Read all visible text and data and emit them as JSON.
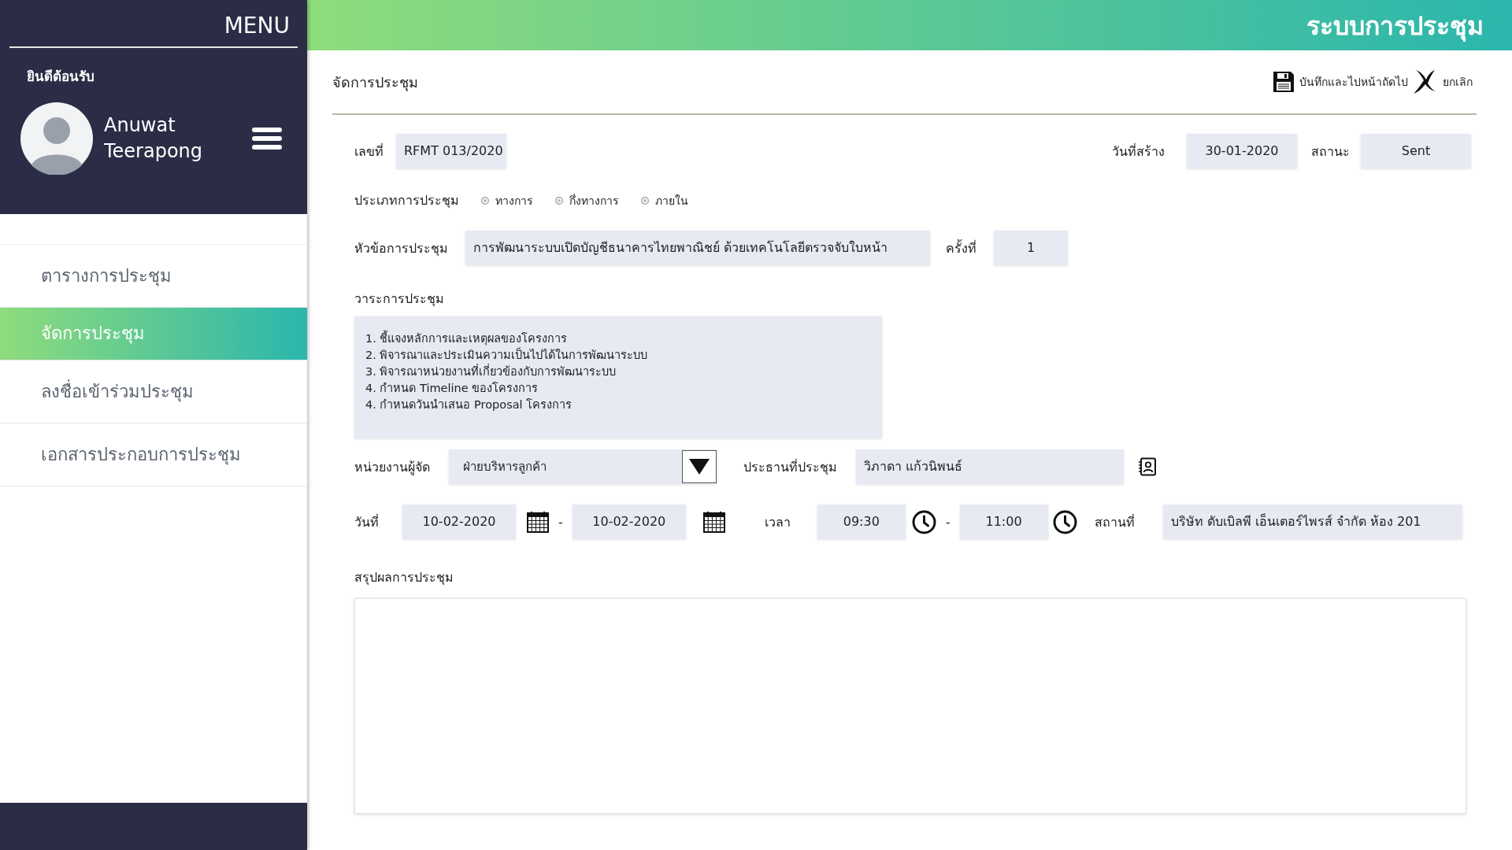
{
  "sidebar": {
    "menu_title": "MENU",
    "welcome": "ยินดีต้อนรับ",
    "user_name": "Anuwat Teerapong",
    "items": [
      {
        "label": "ตารางการประชุม",
        "selected": false
      },
      {
        "label": "จัดการประชุม",
        "selected": true
      },
      {
        "label": "ลงชื่อเข้าร่วมประชุม",
        "selected": false
      },
      {
        "label": "เอกสารประกอบการประชุม",
        "selected": false
      }
    ]
  },
  "header": {
    "title": "ระบบการประชุม"
  },
  "page": {
    "title": "จัดการประชุม",
    "actions": [
      {
        "kind": "save",
        "label": "บันทึกและไปหน้าถัดไป"
      },
      {
        "kind": "cancel",
        "label": "ยกเลิก"
      }
    ]
  },
  "form": {
    "number": {
      "label": "เลขที่",
      "value": "RFMT 013/2020"
    },
    "created": {
      "label": "วันที่สร้าง",
      "value": "30-01-2020"
    },
    "status": {
      "label": "สถานะ",
      "value": "Sent"
    },
    "meeting_type": {
      "label": "ประเภทการประชุม",
      "options": [
        {
          "label": "ทางการ",
          "selected": false
        },
        {
          "label": "กึ่งทางการ",
          "selected": false
        },
        {
          "label": "ภายใน",
          "selected": false
        }
      ]
    },
    "topic": {
      "label": "หัวข้อการประชุม",
      "value": "การพัฒนาระบบเปิดบัญชีธนาคารไทยพาณิชย์ ด้วยเทคโนโลยีตรวจจับใบหน้า"
    },
    "session": {
      "label": "ครั้งที่",
      "value": "1"
    },
    "agenda": {
      "label": "วาระการประชุม",
      "lines": [
        "1. ชี้แจงหลักการและเหตุผลของโครงการ",
        "2. พิจารณาและประเมินความเป็นไปได้ในการพัฒนาระบบ",
        "3. พิจารณาหน่วยงานที่เกี่ยวข้องกับการพัฒนาระบบ",
        "4. กำหนด Timeline ของโครงการ",
        "4. กำหนดวันนำเสนอ Proposal โครงการ"
      ]
    },
    "organizer": {
      "label": "หน่วยงานผู้จัด",
      "value": "ฝ่ายบริหารลูกค้า"
    },
    "chair": {
      "label": "ประธานที่ประชุม",
      "value": "วิภาดา แก้วนิพนธ์"
    },
    "date": {
      "label": "วันที่",
      "start": "10-02-2020",
      "separator": "-",
      "end": "10-02-2020"
    },
    "time": {
      "label": "เวลา",
      "start": "09:30",
      "separator": "-",
      "end": "11:00"
    },
    "venue": {
      "label": "สถานที่",
      "value": "บริษัท ดับเบิลพี เอ็นเตอร์ไพรส์ จำกัด ห้อง 201"
    },
    "summary": {
      "label": "สรุปผลการประชุม"
    }
  }
}
